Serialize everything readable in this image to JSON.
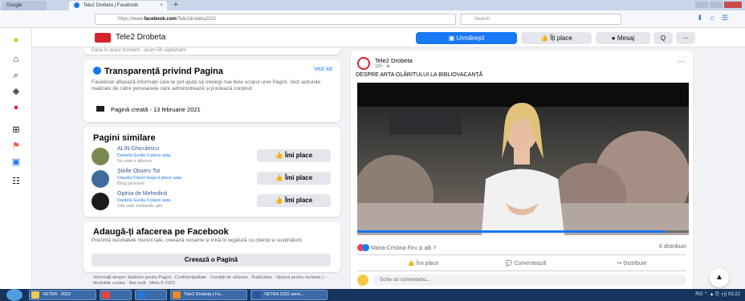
{
  "browser": {
    "inactive_tab": "Google",
    "active_tab": "Tele2 Drobeta | Facebook",
    "url_prefix": "https://www.",
    "url_domain": "facebook.com",
    "url_path": "/Tele2drobeta2021",
    "search_placeholder": "Search"
  },
  "page_header": {
    "name": "Tele2 Drobeta",
    "follow_label": "Urmărești",
    "like_label": "Îți place",
    "message_label": "Mesaj",
    "search_label": "Q",
    "more_label": "⋯"
  },
  "left": {
    "top_fragment": "Pana în acest moment · acum 56 săptămâni",
    "transparency": {
      "title": "Transparență privind Pagina",
      "see_all": "Vezi tot",
      "body": "Facebook afișează informații care te pot ajuta să înțelegi mai bine scopul unei Pagini. Vezi acțiunile realizate de către persoanele care administrează și postează conținut.",
      "created": "Pagină creată - 13 februarie 2021"
    },
    "similar": {
      "title": "Pagini similare",
      "pages": [
        {
          "name": "ALIN Ghiculescu",
          "sub": "Daniela Gurău îi place asta",
          "category": "Nu este o afacere",
          "button": "Îmi place"
        },
        {
          "name": "Știrile Observ Tot",
          "sub": "Claudiu Flavel Hușu îi place asta",
          "category": "Blog personal",
          "button": "Îmi place"
        },
        {
          "name": "Opinia de Mehedinți",
          "sub": "Daniela Gurău îi place asta",
          "category": "Site web mediavite știri",
          "button": "Îmi place"
        }
      ]
    },
    "business": {
      "title": "Adaugă-ți afacerea pe Facebook",
      "body": "Prezintă rezultatele muncii tale, creează reclame și intră în legătură cu clienții și susținătorii.",
      "button": "Creează o Pagină"
    },
    "footer": "Informații despre Statistici pentru Pagini · Confidențialitate · Condiții de utilizare · Publicitate · Opțiuni pentru reclame ▷ · Modulele cookie · Mai mult · Meta © 2022"
  },
  "post": {
    "author": "Tele2 Drobeta",
    "time": "12h · ⊕",
    "text": "DESPRE ARTA OLĂRITULUI LA BIBLIOVACANȚĂ",
    "video_progress": 0.93,
    "reactions": "Maria-Cristina Firu și alți 7",
    "shares": "6 distribuiri",
    "like_action": "Îmi place",
    "comment_action": "Comentează",
    "share_action": "Distribuie",
    "comment_placeholder": "Scrie un comentariu..."
  },
  "taskbar": {
    "tasks": [
      "VETRA · 2022",
      "",
      "",
      "Tele2 Drobeta | Fa...",
      "VETRA 2022 alem..."
    ],
    "tray": "RO  ⌃  ▲  ⎘  ◖))  03:22"
  },
  "colors": {
    "fb_blue": "#1877f2",
    "tele2_red": "#d8232a",
    "taskbar": "#16345c"
  }
}
